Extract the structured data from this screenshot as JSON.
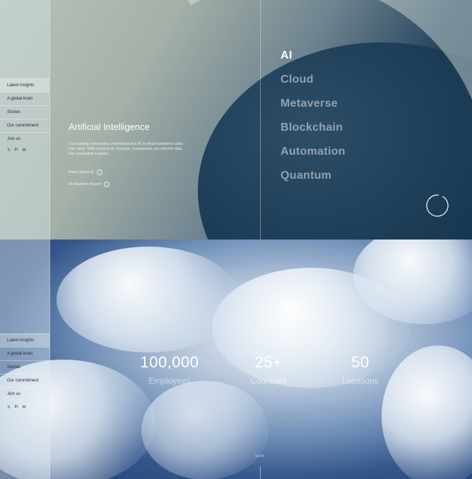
{
  "sidebar": {
    "items": [
      "Latest insights",
      "A global brain",
      "Stories",
      "Our commitment",
      "Join us"
    ],
    "social_icons": [
      "twitter-icon",
      "linkedin-icon",
      "email-icon"
    ]
  },
  "hero": {
    "title": "Artificial Intelligence",
    "description": "The leading companies understand that AI is what transforms data into value. With Centure AI Services, businesses can convert data into actionable insights.",
    "links": [
      {
        "label": "Meet Otovis AI",
        "icon": "arrow-circle-icon"
      },
      {
        "label": "AI Adoption Report",
        "icon": "arrow-circle-icon"
      }
    ]
  },
  "topics": [
    "AI",
    "Cloud",
    "Metaverse",
    "Blockchain",
    "Automation",
    "Quantum"
  ],
  "stats": [
    {
      "value": "100,000",
      "label": "Employees"
    },
    {
      "value": "25+",
      "label": "Countries"
    },
    {
      "value": "50",
      "label": "Locations"
    }
  ],
  "scroll_label": "Scroll",
  "colors": {
    "accent": "#ffffff",
    "dark": "#0f2d45"
  }
}
